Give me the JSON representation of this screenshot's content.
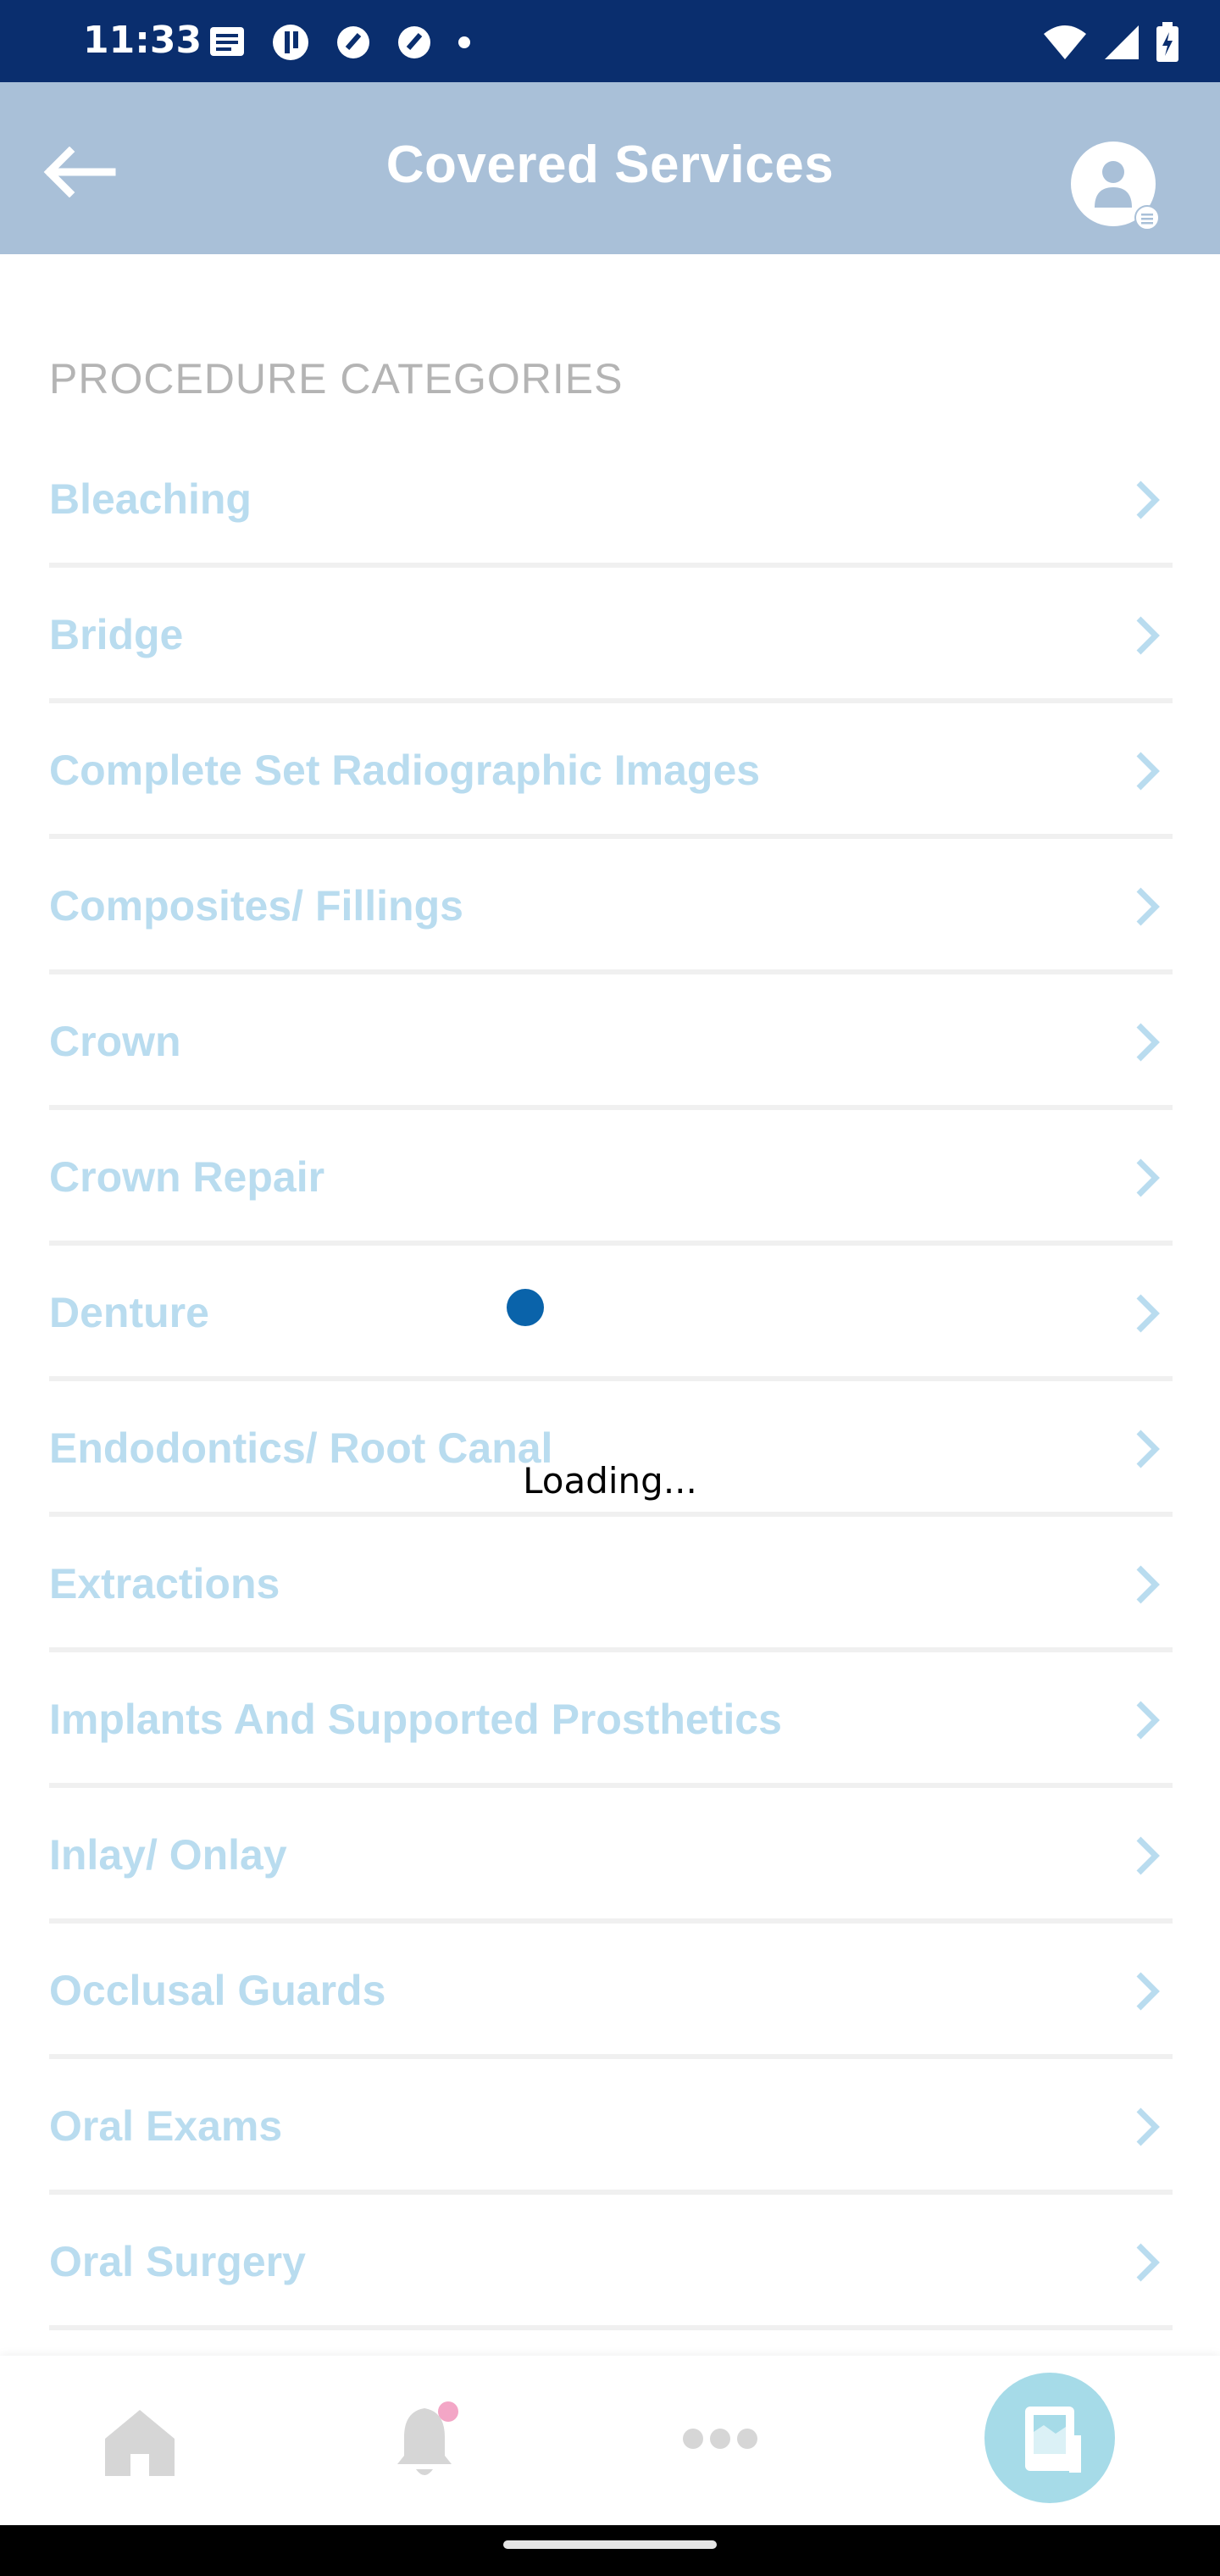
{
  "status_bar": {
    "time": "11:33",
    "left_icons": [
      "message-icon",
      "app-notification-icon",
      "app-notification-icon",
      "app-notification-icon",
      "dot-icon"
    ],
    "right_icons": [
      "wifi-icon",
      "signal-icon",
      "battery-icon"
    ]
  },
  "header": {
    "title": "Covered Services",
    "back_icon": "arrow-left-icon",
    "avatar_icon": "user-avatar-icon",
    "bg_color": "#a9c0d8"
  },
  "categories": {
    "header": "PROCEDURE CATEGORIES",
    "items": [
      {
        "label": "Bleaching"
      },
      {
        "label": "Bridge"
      },
      {
        "label": "Complete Set Radiographic Images"
      },
      {
        "label": "Composites/ Fillings"
      },
      {
        "label": "Crown"
      },
      {
        "label": "Crown Repair"
      },
      {
        "label": "Denture"
      },
      {
        "label": "Endodontics/ Root Canal"
      },
      {
        "label": "Extractions"
      },
      {
        "label": "Implants And Supported Prosthetics"
      },
      {
        "label": "Inlay/ Onlay"
      },
      {
        "label": "Occlusal Guards"
      },
      {
        "label": "Oral Exams"
      },
      {
        "label": "Oral Surgery"
      }
    ],
    "label_color": "#b9dcef",
    "chevron_color": "#b9dcef"
  },
  "loading": {
    "text": "Loading...",
    "dot_color": "#0a63aa"
  },
  "bottom_nav": {
    "items": [
      {
        "icon": "home-icon"
      },
      {
        "icon": "bell-icon"
      },
      {
        "icon": "more-icon"
      },
      {
        "icon": "id-card-icon"
      }
    ],
    "fab_color": "#a6dbe8"
  }
}
